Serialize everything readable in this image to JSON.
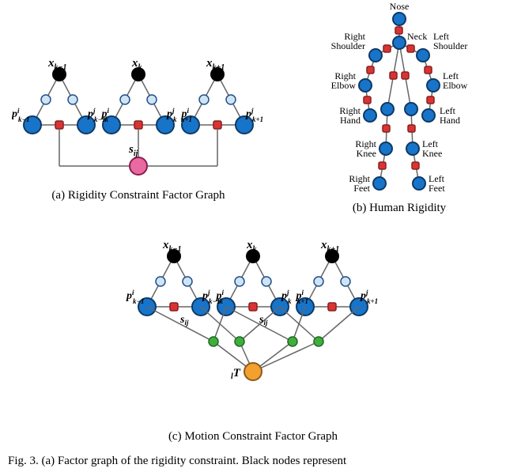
{
  "figs": {
    "a": {
      "caption": "(a) Rigidity Constraint Factor Graph",
      "nodes": {
        "x_km1": "x",
        "x_k": "x",
        "x_kp1": "x",
        "p_i_km1": "p",
        "p_j_km1": "p",
        "p_i_k": "p",
        "p_j_k": "p",
        "p_i_kp1": "p",
        "p_j_kp1": "p",
        "s_ij": "s"
      },
      "labels": {
        "x_km1_sub": "k−1",
        "x_k_sub": "k",
        "x_kp1_sub": "k+1",
        "p_i_km1_sup": "i",
        "p_i_km1_sub": "k−1",
        "p_j_km1_sup": "j",
        "p_j_km1_sub": "k−1",
        "p_i_k_sup": "i",
        "p_i_k_sub": "k",
        "p_j_k_sup": "j",
        "p_j_k_sub": "k",
        "p_i_kp1_sup": "i",
        "p_i_kp1_sub": "k+1",
        "p_j_kp1_sup": "j",
        "p_j_kp1_sub": "k+1",
        "s_ij_sub": "ij"
      }
    },
    "b": {
      "caption": "(b) Human Rigidity",
      "joints": {
        "nose": "Nose",
        "neck": "Neck",
        "r_shoulder": "Right Shoulder",
        "l_shoulder": "Left Shoulder",
        "r_elbow": "Right Elbow",
        "l_elbow": "Left Elbow",
        "r_hand": "Right Hand",
        "l_hand": "Left Hand",
        "r_knee": "Right Knee",
        "l_knee": "Left Knee",
        "r_feet": "Right Feet",
        "l_feet": "Left Feet"
      }
    },
    "c": {
      "caption": "(c) Motion Constraint Factor Graph",
      "nodes": {
        "x_km1": "x",
        "x_k": "x",
        "x_kp1": "x",
        "p_i_km1": "p",
        "p_j_km1": "p",
        "p_i_k": "p",
        "p_j_k": "p",
        "p_i_kp1": "p",
        "p_j_kp1": "p",
        "lT": "T"
      },
      "labels": {
        "x_km1_sub": "k−1",
        "x_k_sub": "k",
        "x_kp1_sub": "k+1",
        "p_i_km1_sup": "i",
        "p_i_km1_sub": "k−1",
        "p_j_km1_sup": "j",
        "p_j_km1_sub": "k−1",
        "p_i_k_sup": "i",
        "p_i_k_sub": "k",
        "p_j_k_sup": "j",
        "p_j_k_sub": "k",
        "p_i_kp1_sup": "i",
        "p_i_kp1_sub": "k+1",
        "p_j_kp1_sup": "j",
        "p_j_kp1_sub": "k+1",
        "s_ij_a": "s",
        "s_ij_a_sub": "ij",
        "s_ij_b": "s",
        "s_ij_b_sub": "ij",
        "lT_pre": "l"
      }
    }
  },
  "cutoff": "Fig. 3.    (a)  Factor  graph  of  the  rigidity  constraint.  Black  nodes  represent"
}
